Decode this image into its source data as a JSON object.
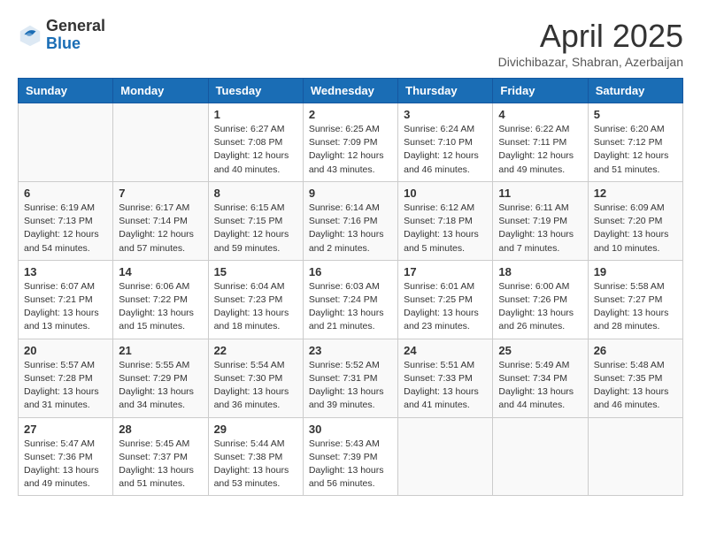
{
  "header": {
    "logo_general": "General",
    "logo_blue": "Blue",
    "month": "April 2025",
    "location": "Divichibazar, Shabran, Azerbaijan"
  },
  "weekdays": [
    "Sunday",
    "Monday",
    "Tuesday",
    "Wednesday",
    "Thursday",
    "Friday",
    "Saturday"
  ],
  "weeks": [
    [
      {
        "day": "",
        "info": ""
      },
      {
        "day": "",
        "info": ""
      },
      {
        "day": "1",
        "info": "Sunrise: 6:27 AM\nSunset: 7:08 PM\nDaylight: 12 hours and 40 minutes."
      },
      {
        "day": "2",
        "info": "Sunrise: 6:25 AM\nSunset: 7:09 PM\nDaylight: 12 hours and 43 minutes."
      },
      {
        "day": "3",
        "info": "Sunrise: 6:24 AM\nSunset: 7:10 PM\nDaylight: 12 hours and 46 minutes."
      },
      {
        "day": "4",
        "info": "Sunrise: 6:22 AM\nSunset: 7:11 PM\nDaylight: 12 hours and 49 minutes."
      },
      {
        "day": "5",
        "info": "Sunrise: 6:20 AM\nSunset: 7:12 PM\nDaylight: 12 hours and 51 minutes."
      }
    ],
    [
      {
        "day": "6",
        "info": "Sunrise: 6:19 AM\nSunset: 7:13 PM\nDaylight: 12 hours and 54 minutes."
      },
      {
        "day": "7",
        "info": "Sunrise: 6:17 AM\nSunset: 7:14 PM\nDaylight: 12 hours and 57 minutes."
      },
      {
        "day": "8",
        "info": "Sunrise: 6:15 AM\nSunset: 7:15 PM\nDaylight: 12 hours and 59 minutes."
      },
      {
        "day": "9",
        "info": "Sunrise: 6:14 AM\nSunset: 7:16 PM\nDaylight: 13 hours and 2 minutes."
      },
      {
        "day": "10",
        "info": "Sunrise: 6:12 AM\nSunset: 7:18 PM\nDaylight: 13 hours and 5 minutes."
      },
      {
        "day": "11",
        "info": "Sunrise: 6:11 AM\nSunset: 7:19 PM\nDaylight: 13 hours and 7 minutes."
      },
      {
        "day": "12",
        "info": "Sunrise: 6:09 AM\nSunset: 7:20 PM\nDaylight: 13 hours and 10 minutes."
      }
    ],
    [
      {
        "day": "13",
        "info": "Sunrise: 6:07 AM\nSunset: 7:21 PM\nDaylight: 13 hours and 13 minutes."
      },
      {
        "day": "14",
        "info": "Sunrise: 6:06 AM\nSunset: 7:22 PM\nDaylight: 13 hours and 15 minutes."
      },
      {
        "day": "15",
        "info": "Sunrise: 6:04 AM\nSunset: 7:23 PM\nDaylight: 13 hours and 18 minutes."
      },
      {
        "day": "16",
        "info": "Sunrise: 6:03 AM\nSunset: 7:24 PM\nDaylight: 13 hours and 21 minutes."
      },
      {
        "day": "17",
        "info": "Sunrise: 6:01 AM\nSunset: 7:25 PM\nDaylight: 13 hours and 23 minutes."
      },
      {
        "day": "18",
        "info": "Sunrise: 6:00 AM\nSunset: 7:26 PM\nDaylight: 13 hours and 26 minutes."
      },
      {
        "day": "19",
        "info": "Sunrise: 5:58 AM\nSunset: 7:27 PM\nDaylight: 13 hours and 28 minutes."
      }
    ],
    [
      {
        "day": "20",
        "info": "Sunrise: 5:57 AM\nSunset: 7:28 PM\nDaylight: 13 hours and 31 minutes."
      },
      {
        "day": "21",
        "info": "Sunrise: 5:55 AM\nSunset: 7:29 PM\nDaylight: 13 hours and 34 minutes."
      },
      {
        "day": "22",
        "info": "Sunrise: 5:54 AM\nSunset: 7:30 PM\nDaylight: 13 hours and 36 minutes."
      },
      {
        "day": "23",
        "info": "Sunrise: 5:52 AM\nSunset: 7:31 PM\nDaylight: 13 hours and 39 minutes."
      },
      {
        "day": "24",
        "info": "Sunrise: 5:51 AM\nSunset: 7:33 PM\nDaylight: 13 hours and 41 minutes."
      },
      {
        "day": "25",
        "info": "Sunrise: 5:49 AM\nSunset: 7:34 PM\nDaylight: 13 hours and 44 minutes."
      },
      {
        "day": "26",
        "info": "Sunrise: 5:48 AM\nSunset: 7:35 PM\nDaylight: 13 hours and 46 minutes."
      }
    ],
    [
      {
        "day": "27",
        "info": "Sunrise: 5:47 AM\nSunset: 7:36 PM\nDaylight: 13 hours and 49 minutes."
      },
      {
        "day": "28",
        "info": "Sunrise: 5:45 AM\nSunset: 7:37 PM\nDaylight: 13 hours and 51 minutes."
      },
      {
        "day": "29",
        "info": "Sunrise: 5:44 AM\nSunset: 7:38 PM\nDaylight: 13 hours and 53 minutes."
      },
      {
        "day": "30",
        "info": "Sunrise: 5:43 AM\nSunset: 7:39 PM\nDaylight: 13 hours and 56 minutes."
      },
      {
        "day": "",
        "info": ""
      },
      {
        "day": "",
        "info": ""
      },
      {
        "day": "",
        "info": ""
      }
    ]
  ]
}
